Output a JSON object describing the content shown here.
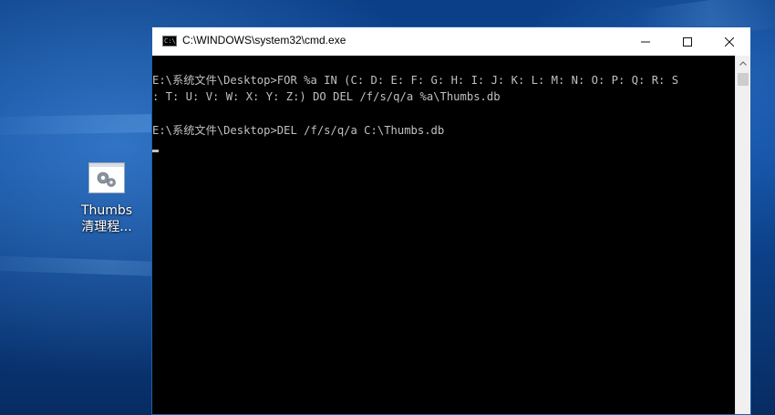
{
  "desktop": {
    "icon_label_line1": "Thumbs",
    "icon_label_line2": "清理程..."
  },
  "window": {
    "title": "C:\\WINDOWS\\system32\\cmd.exe",
    "app_icon_text": "C:\\"
  },
  "console": {
    "lines": [
      "E:\\系统文件\\Desktop>FOR %a IN (C: D: E: F: G: H: I: J: K: L: M: N: O: P: Q: R: S",
      ": T: U: V: W: X: Y: Z:) DO DEL /f/s/q/a %a\\Thumbs.db",
      "",
      "E:\\系统文件\\Desktop>DEL /f/s/q/a C:\\Thumbs.db"
    ]
  },
  "colors": {
    "console_bg": "#000000",
    "console_text": "#c0c0c0",
    "window_border": "#1e5da8"
  },
  "icons": [
    "cmd-app-icon",
    "minimize-icon",
    "maximize-icon",
    "close-icon",
    "scroll-up-icon",
    "settings-gear-file-icon"
  ]
}
